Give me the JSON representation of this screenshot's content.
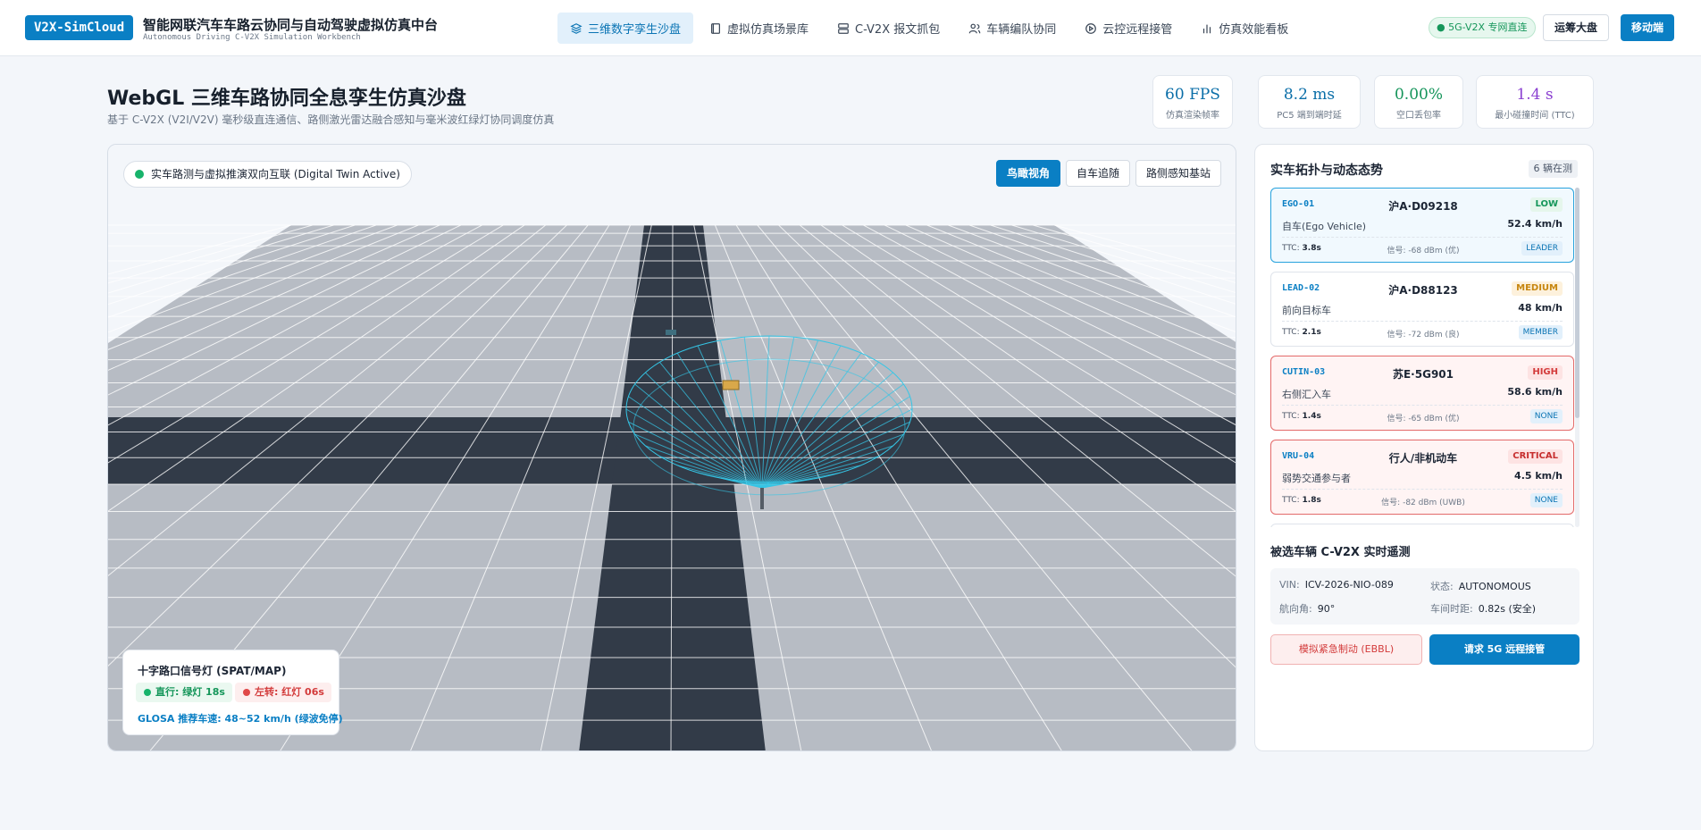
{
  "header": {
    "logo": "V2X-SimCloud",
    "title": "智能网联汽车车路云协同与自动驾驶虚拟仿真中台",
    "subtitle": "Autonomous Driving C-V2X Simulation Workbench",
    "nav": [
      {
        "label": "三维数字孪生沙盘",
        "icon": "layers-icon",
        "active": true
      },
      {
        "label": "虚拟仿真场景库",
        "icon": "book-icon",
        "active": false
      },
      {
        "label": "C-V2X 报文抓包",
        "icon": "server-icon",
        "active": false
      },
      {
        "label": "车辆编队协同",
        "icon": "users-icon",
        "active": false
      },
      {
        "label": "云控远程接管",
        "icon": "play-circle-icon",
        "active": false
      },
      {
        "label": "仿真效能看板",
        "icon": "bar-chart-icon",
        "active": false
      }
    ],
    "network_badge": "● 5G-V2X 专网直连",
    "ops_button": "运筹大盘",
    "mobile_button": "移动端"
  },
  "page": {
    "title": "WebGL 三维车路协同全息孪生仿真沙盘",
    "description": "基于 C-V2X (V2I/V2V) 毫秒级直连通信、路侧激光雷达融合感知与毫米波红绿灯协同调度仿真"
  },
  "metrics": [
    {
      "value": "60 FPS",
      "label": "仿真渲染帧率",
      "color": "#0a6ea8"
    },
    {
      "value": "8.2 ms",
      "label": "PC5 端到端时延",
      "color": "#0a6ea8"
    },
    {
      "value": "0.00%",
      "label": "空口丢包率",
      "color": "#14945a"
    },
    {
      "value": "1.4 s",
      "label": "最小碰撞时间 (TTC)",
      "color": "#8a3fd1"
    }
  ],
  "sandbox": {
    "twin_badge": "实车路测与虚拟推演双向互联 (Digital Twin Active)",
    "views": [
      {
        "label": "鸟瞰视角",
        "active": true
      },
      {
        "label": "自车追随",
        "active": false
      },
      {
        "label": "路侧感知基站",
        "active": false
      }
    ],
    "signal": {
      "title": "十字路口信号灯 (SPAT/MAP)",
      "straight": "直行: 绿灯 18s",
      "left": "左转: 红灯 06s",
      "glosa": "GLOSA 推荐车速: 48~52 km/h (绿波免停)"
    }
  },
  "panel": {
    "title": "实车拓扑与动态态势",
    "count": "6 辆在测",
    "vehicles": [
      {
        "id": "EGO-01",
        "plate": "沪A·D09218",
        "risk": "LOW",
        "role": "自车(Ego Vehicle)",
        "speed": "52.4 km/h",
        "ttc_label": "TTC:",
        "ttc": "3.8s",
        "signal": "信号: -68 dBm (优)",
        "team": "LEADER"
      },
      {
        "id": "LEAD-02",
        "plate": "沪A·D88123",
        "risk": "MEDIUM",
        "role": "前向目标车",
        "speed": "48 km/h",
        "ttc_label": "TTC:",
        "ttc": "2.1s",
        "signal": "信号: -72 dBm (良)",
        "team": "MEMBER"
      },
      {
        "id": "CUTIN-03",
        "plate": "苏E·5G901",
        "risk": "HIGH",
        "role": "右侧汇入车",
        "speed": "58.6 km/h",
        "ttc_label": "TTC:",
        "ttc": "1.4s",
        "signal": "信号: -65 dBm (优)",
        "team": "NONE"
      },
      {
        "id": "VRU-04",
        "plate": "行人/非机动车",
        "risk": "CRITICAL",
        "role": "弱势交通参与者",
        "speed": "4.5 km/h",
        "ttc_label": "TTC:",
        "ttc": "1.8s",
        "signal": "信号: -82 dBm (UWB)",
        "team": "NONE"
      }
    ],
    "telemetry": {
      "title": "被选车辆 C-V2X 实时遥测",
      "vin_label": "VIN:",
      "vin": "ICV-2026-NIO-089",
      "state_label": "状态:",
      "state": "AUTONOMOUS",
      "heading_label": "航向角:",
      "heading": "90°",
      "gap_label": "车间时距:",
      "gap": "0.82s (安全)"
    },
    "ebbl_button": "模拟紧急制动 (EBBL)",
    "takeover_button": "请求 5G 远程接管"
  }
}
